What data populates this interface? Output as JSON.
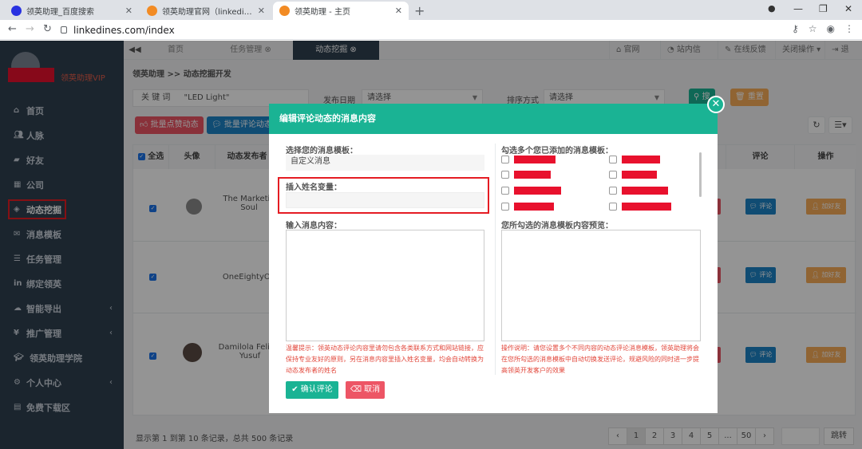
{
  "browser": {
    "tabs": [
      {
        "title": "领英助理_百度搜索",
        "active": false
      },
      {
        "title": "领英助理官网（linkedines.com）",
        "active": false
      },
      {
        "title": "领英助理 - 主页",
        "active": true
      }
    ],
    "url": "linkedines.com/index"
  },
  "sidebar": {
    "vip_label": "领英助理VIP",
    "items": [
      {
        "label": "首页",
        "icon": "home-icon"
      },
      {
        "label": "人脉",
        "icon": "users-icon"
      },
      {
        "label": "好友",
        "icon": "chat-icon"
      },
      {
        "label": "公司",
        "icon": "building-icon"
      },
      {
        "label": "动态挖掘",
        "icon": "compass-icon",
        "active": true
      },
      {
        "label": "消息模板",
        "icon": "envelope-icon"
      },
      {
        "label": "任务管理",
        "icon": "list-icon"
      },
      {
        "label": "绑定领英",
        "icon": "linkedin-icon"
      },
      {
        "label": "智能导出",
        "icon": "cloud-icon",
        "arrow": true
      },
      {
        "label": "推广管理",
        "icon": "yen-icon",
        "arrow": true
      },
      {
        "label": "领英助理学院",
        "icon": "graduation-icon"
      },
      {
        "label": "个人中心",
        "icon": "gear-icon",
        "arrow": true
      },
      {
        "label": "免费下载区",
        "icon": "file-icon"
      }
    ]
  },
  "app_tabs": [
    {
      "label": "首页"
    },
    {
      "label": "任务管理"
    },
    {
      "label": "动态挖掘",
      "active": true
    }
  ],
  "top_links": [
    "官网",
    "站内信",
    "在线反馈",
    "关闭操作",
    "退出"
  ],
  "breadcrumb": "领英助理 >> 动态挖掘开发",
  "filters": {
    "keyword_label": "关 键 词",
    "keyword_value": "\"LED Light\"",
    "date_label": "发布日期",
    "date_value": "请选择",
    "sort_label": "排序方式",
    "sort_value": "请选择",
    "search_btn": "搜",
    "reset_btn": "重置"
  },
  "actions": {
    "bulk_like": "批量点赞动态",
    "bulk_comment": "批量评论动态"
  },
  "table": {
    "headers": {
      "select_all": "全选",
      "avatar": "头像",
      "publisher": "动态发布者",
      "comment": "评论",
      "operate": "操作"
    },
    "rows": [
      {
        "publisher": "The Marketin Soul",
        "comment_btn": "评论",
        "add_btn": "加好友"
      },
      {
        "publisher": "OneEightyOn",
        "comment_btn": "评论",
        "add_btn": "加好友"
      },
      {
        "publisher": "Damilola Felicia Yusuf",
        "comment_btn": "评论",
        "add_btn": "加好友"
      }
    ],
    "footer": "显示第 1 到第 10 条记录，总共 500 条记录",
    "pages": [
      "‹",
      "1",
      "2",
      "3",
      "4",
      "5",
      "...",
      "50",
      "›"
    ],
    "jump": "跳转"
  },
  "modal": {
    "title": "编辑评论动态的消息内容",
    "template_label": "选择您的消息模板：",
    "template_value": "自定义消息",
    "name_var_label": "插入姓名变量：",
    "content_label": "输入消息内容：",
    "multi_label": "勾选多个您已添加的消息模板：",
    "preview_label": "您所勾选的消息模板内容预览：",
    "tip": "温馨提示：领英动态评论内容里请勿包含各类联系方式和网站链接，应保持专业友好的原则，另在消息内容里插入姓名变量，均会自动转换为动态发布者的姓名",
    "note": "操作说明：请您设置多个不同内容的动态评论消息模板，领英助理将会在您所勾选的消息模板中自动切换发送评论，规避风险的同时进一步提高领英开发客户的效果",
    "confirm": "确认评论",
    "cancel": "取消"
  },
  "colors": {
    "accent": "#1ab394",
    "danger": "#ed5565",
    "sidebar_bg": "#2f4050",
    "warning": "#f8ac59",
    "info": "#1c84c6",
    "highlight": "#e51c23"
  }
}
